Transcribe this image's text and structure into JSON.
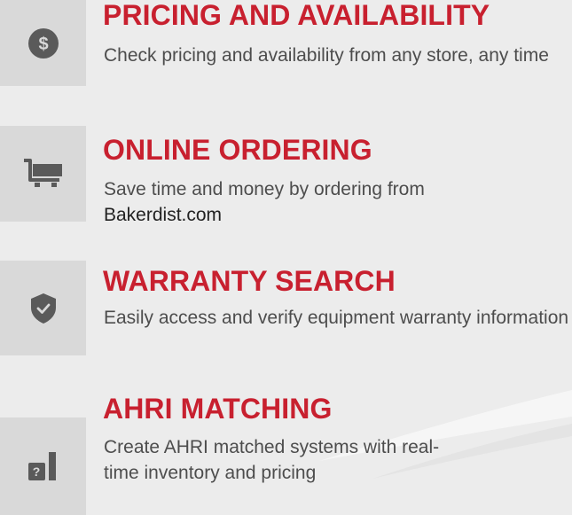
{
  "features": [
    {
      "title": "PRICING AND AVAILABILITY",
      "description": "Check pricing and availability from any store, any time",
      "icon": "dollar-icon"
    },
    {
      "title": "ONLINE ORDERING",
      "description_prefix": "Save time and money by ordering from",
      "link_text": "Bakerdist.com",
      "icon": "cart-icon"
    },
    {
      "title": "WARRANTY SEARCH",
      "description": "Easily access and verify equipment warranty information",
      "icon": "shield-check-icon"
    },
    {
      "title": "AHRI MATCHING",
      "description": "Create AHRI matched systems with real-time inventory and pricing",
      "icon": "question-chart-icon",
      "icon_symbol": "?"
    }
  ],
  "colors": {
    "title": "#c8202f",
    "text": "#4d4d4d",
    "icon": "#5a5a5a",
    "tile": "#d9d9d9",
    "background": "#ececec"
  }
}
